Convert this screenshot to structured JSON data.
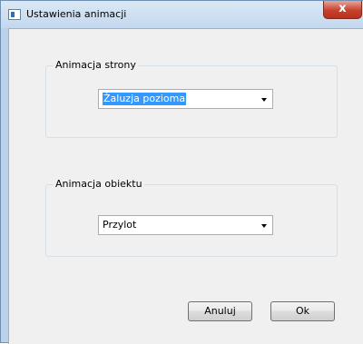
{
  "window": {
    "title": "Ustawienia animacji",
    "close_label": "x",
    "app_icon": "window-app-icon"
  },
  "page_animation": {
    "group_label": "Animacja strony",
    "selected_value": "Żaluzja pozioma"
  },
  "object_animation": {
    "group_label": "Animacja obiektu",
    "selected_value": "Przylot"
  },
  "buttons": {
    "cancel_label": "Anuluj",
    "ok_label": "Ok"
  },
  "colors": {
    "selection_highlight": "#3399ff",
    "close_button": "#c7412d"
  }
}
